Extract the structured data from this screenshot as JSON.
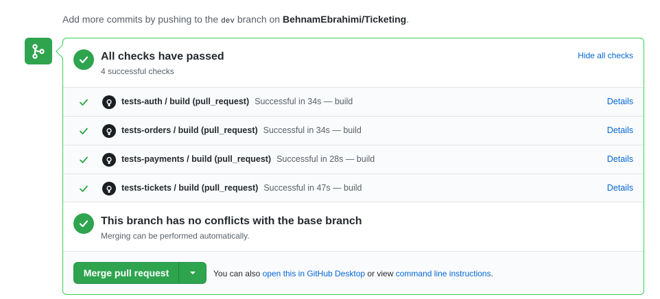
{
  "header_note": {
    "prefix": "Add more commits by pushing to the",
    "branch": "dev",
    "middle": "branch on",
    "repo": "BehnamEbrahimi/Ticketing",
    "suffix": "."
  },
  "checks": {
    "title": "All checks have passed",
    "subtitle": "4 successful checks",
    "toggle_label": "Hide all checks",
    "rows": [
      {
        "name": "tests-auth / build (pull_request)",
        "status": "Successful in 34s — build",
        "details": "Details"
      },
      {
        "name": "tests-orders / build (pull_request)",
        "status": "Successful in 34s — build",
        "details": "Details"
      },
      {
        "name": "tests-payments / build (pull_request)",
        "status": "Successful in 28s — build",
        "details": "Details"
      },
      {
        "name": "tests-tickets / build (pull_request)",
        "status": "Successful in 47s — build",
        "details": "Details"
      }
    ]
  },
  "conflicts": {
    "title": "This branch has no conflicts with the base branch",
    "subtitle": "Merging can be performed automatically."
  },
  "merge": {
    "button_label": "Merge pull request",
    "alt_prefix": "You can also",
    "desktop_link": "open this in GitHub Desktop",
    "alt_middle": "or view",
    "cli_link": "command line instructions",
    "alt_suffix": "."
  },
  "colors": {
    "success": "#2ea44f",
    "link": "#0366d6",
    "border_success": "#34d058"
  },
  "icons": {
    "timeline": "git-merge-icon",
    "status": "check-circle-icon",
    "row_status": "check-icon",
    "app": "github-logo-icon",
    "dropdown": "triangle-down-icon"
  }
}
